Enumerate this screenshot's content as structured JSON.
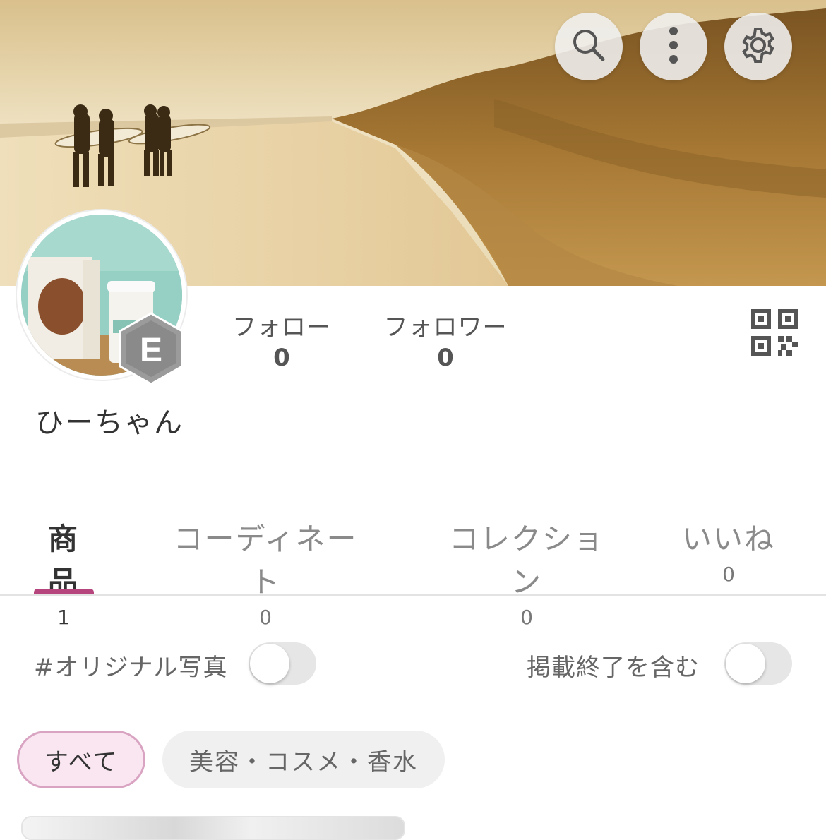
{
  "cover": {
    "image": "beach-surfers-sepia-photo"
  },
  "header_actions": [
    {
      "name": "search-button",
      "icon": "search-icon"
    },
    {
      "name": "more-button",
      "icon": "more-vertical-icon"
    },
    {
      "name": "settings-button",
      "icon": "gear-icon"
    }
  ],
  "profile": {
    "avatar": "coffee-cup-photo",
    "badge_letter": "E",
    "username": "ひーちゃん",
    "follow_label": "フォロー",
    "follow_count": "0",
    "follower_label": "フォロワー",
    "follower_count": "0",
    "qr": "qr-code-icon"
  },
  "tabs": [
    {
      "label": "商品",
      "count": "1",
      "active": true
    },
    {
      "label": "コーディネート",
      "count": "0",
      "active": false
    },
    {
      "label": "コレクション",
      "count": "0",
      "active": false
    },
    {
      "label": "いいね",
      "count": "0",
      "active": false
    }
  ],
  "filters": {
    "original_photo_label": "#オリジナル写真",
    "original_photo_on": false,
    "include_ended_label": "掲載終了を含む",
    "include_ended_on": false
  },
  "categories": [
    {
      "label": "すべて",
      "selected": true
    },
    {
      "label": "美容・コスメ・香水",
      "selected": false
    }
  ],
  "colors": {
    "accent": "#b6457e",
    "chip_selected_bg": "#f9e6f1",
    "chip_selected_border": "#d9a3c2"
  }
}
